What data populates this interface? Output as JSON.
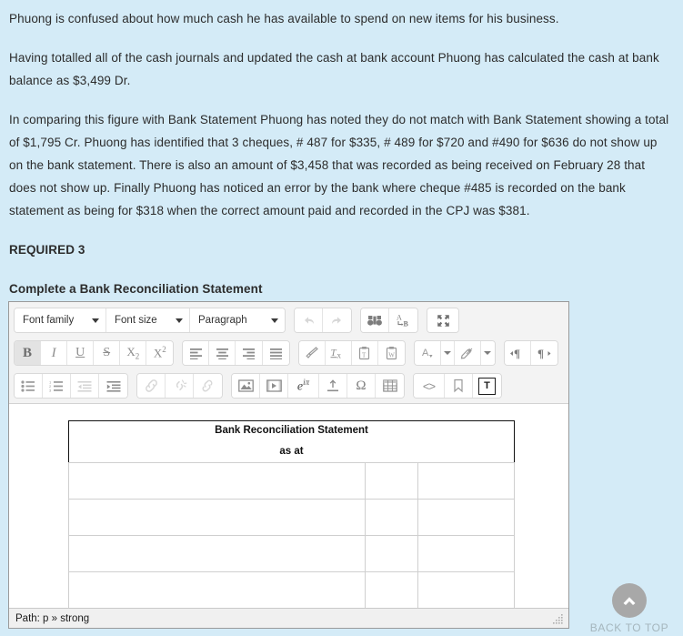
{
  "background_color": "#d4ebf7",
  "prose": {
    "paragraphs": [
      "Phuong is confused about how much cash he has available to spend on new items for his business.",
      "Having totalled all of the cash journals and updated the cash at bank account Phuong has calculated the cash at bank balance as $3,499 Dr.",
      "In comparing this figure with Bank Statement Phuong has noted they do not match with Bank Statement showing a total of $1,795 Cr. Phuong has identified that 3 cheques, # 487 for $335, # 489 for $720 and #490 for $636 do not show up on the bank statement. There is also an amount of $3,458 that was recorded as being received on February 28 that does not show up. Finally Phuong has noticed an error by the bank where cheque #485 is recorded on the bank statement as being for $318 when the correct amount paid and recorded in the CPJ was $381."
    ],
    "required_heading": "REQUIRED 3",
    "sub_heading": "Complete a Bank Reconciliation Statement"
  },
  "editor": {
    "toolbar": {
      "row1": {
        "font_family_label": "Font family",
        "font_size_label": "Font size",
        "paragraph_label": "Paragraph",
        "undo_title": "Undo",
        "redo_title": "Redo",
        "find_title": "Find",
        "replace_title": "Find and replace",
        "fullscreen_title": "Fullscreen"
      },
      "row2": {
        "bold_label": "B",
        "italic_label": "I",
        "underline_label": "U",
        "strikethrough_label": "S",
        "subscript_label": "X",
        "subscript_index": "2",
        "superscript_label": "X",
        "superscript_index": "2",
        "align_left_title": "Align left",
        "align_center_title": "Align center",
        "align_right_title": "Align right",
        "align_justify_title": "Justify",
        "format_painter_title": "Format painter",
        "remove_format_title": "Remove formatting",
        "paste_text_title": "Paste as text",
        "paste_word_title": "Paste from Word",
        "text_color_title": "Text color",
        "background_color_title": "Background color",
        "ltr_title": "Left to right",
        "rtl_title": "Right to left"
      },
      "row3": {
        "bullet_list_title": "Bullet list",
        "numbered_list_title": "Numbered list",
        "outdent_title": "Decrease indent",
        "indent_title": "Increase indent",
        "link_title": "Insert link",
        "unlink_title": "Remove link",
        "anchor_title": "Anchor",
        "image_title": "Insert image",
        "media_title": "Insert media",
        "equation_label": "e",
        "equation_sup": "iπ",
        "upload_title": "Upload",
        "special_char_label": "Ω",
        "table_title": "Table",
        "source_code_label": "<>",
        "bookmark_title": "Bookmark",
        "template_label": "T"
      }
    },
    "table": {
      "title": "Bank Reconciliation Statement",
      "as_at": "as at",
      "columns": [
        "",
        "",
        ""
      ],
      "rows": [
        [
          "",
          "",
          ""
        ],
        [
          "",
          "",
          ""
        ],
        [
          "",
          "",
          ""
        ],
        [
          "",
          "",
          ""
        ]
      ]
    },
    "statusbar": {
      "path_label": "Path: p » strong"
    }
  },
  "back_to_top": {
    "label": "BACK TO TOP",
    "icon": "chevron-up-icon",
    "circle_color": "#a8a8a8",
    "label_color": "#a5b6bd"
  }
}
